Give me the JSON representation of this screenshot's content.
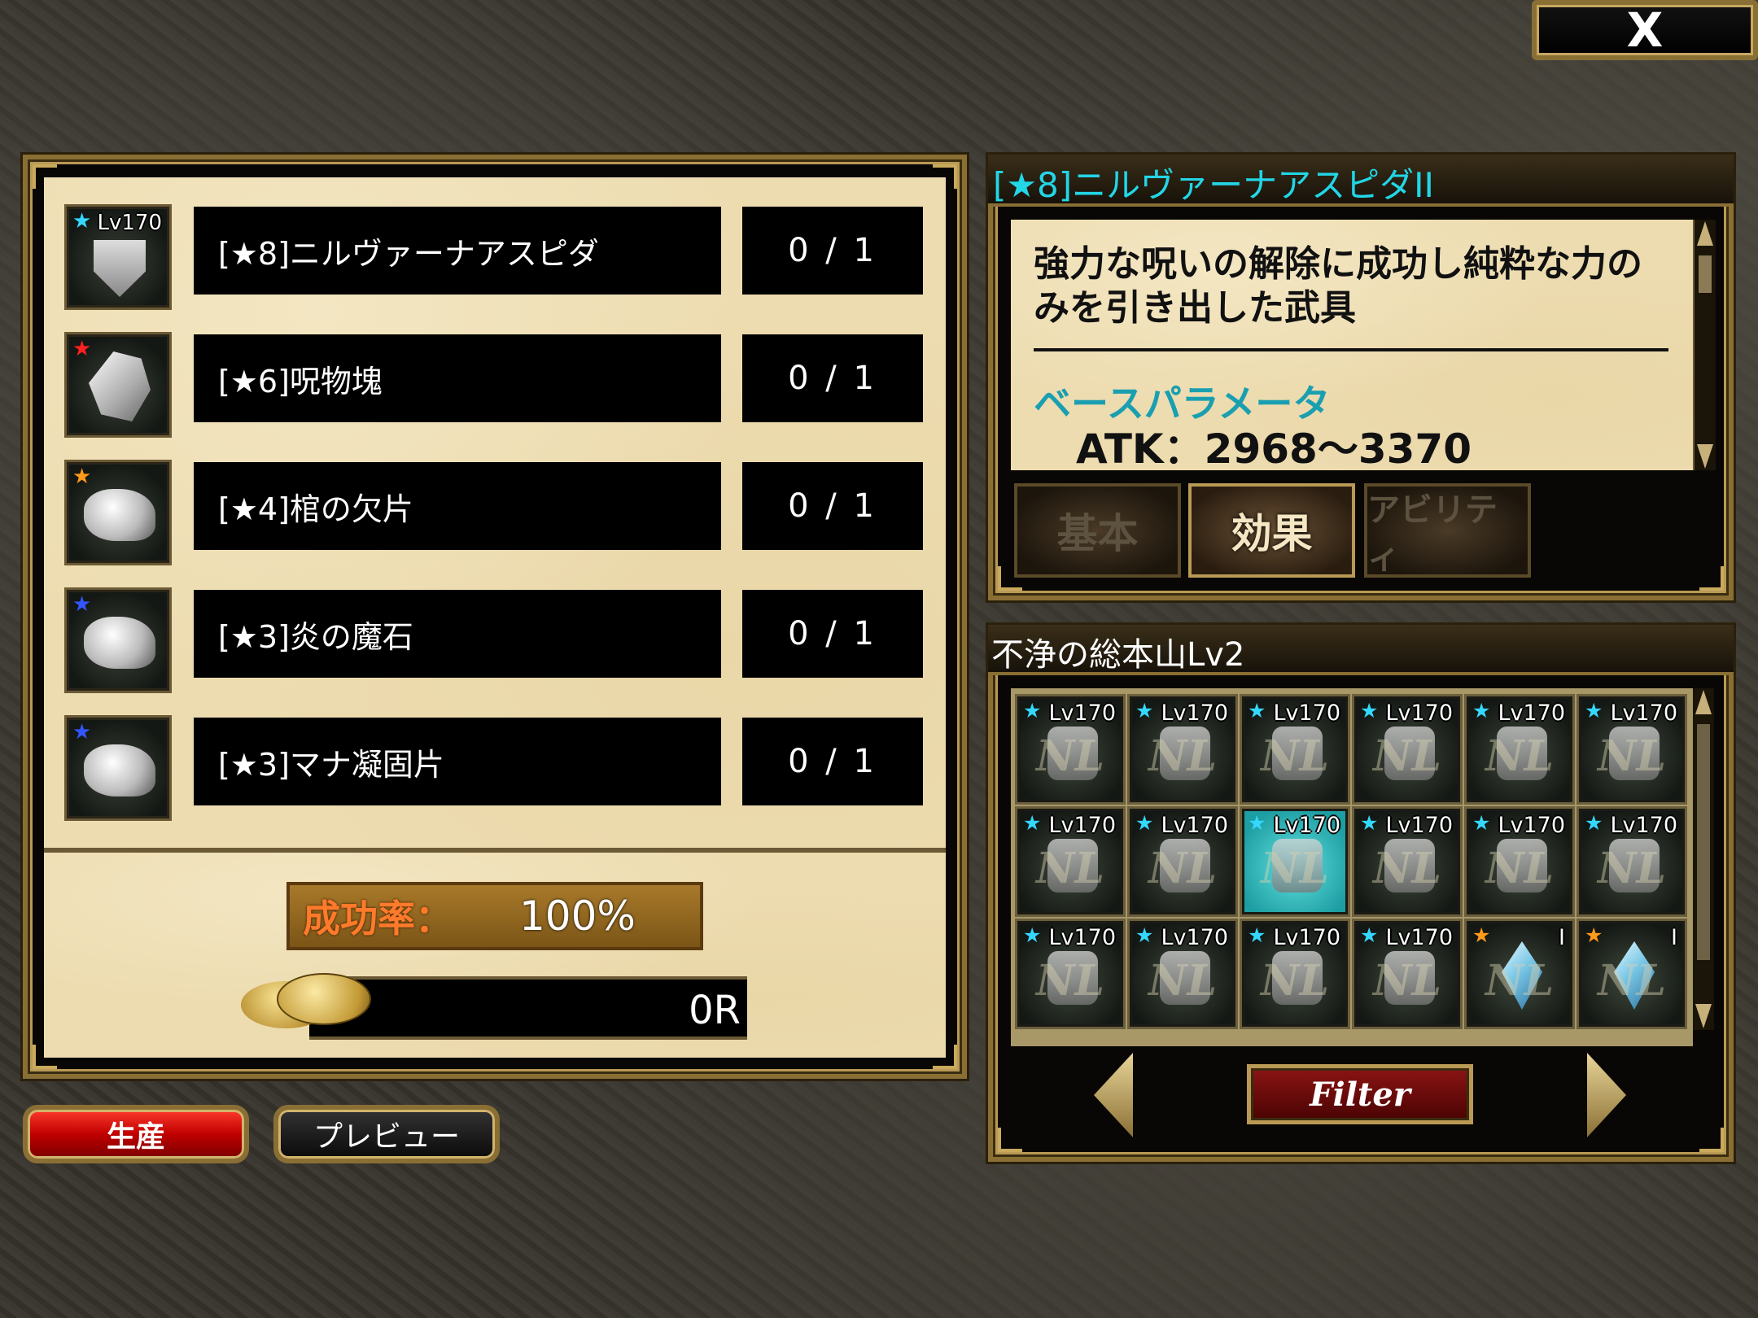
{
  "close_label": "X",
  "recipe": {
    "materials": [
      {
        "name": "[★8]ニルヴァーナアスピダ",
        "count": "0 / 1",
        "star_color": "#34d8ff",
        "lv": "Lv170",
        "icon": "shield-icon"
      },
      {
        "name": "[★6]呪物塊",
        "count": "0 / 1",
        "star_color": "#ff2020",
        "lv": "",
        "icon": "ore-lump-icon"
      },
      {
        "name": "[★4]棺の欠片",
        "count": "0 / 1",
        "star_color": "#ff9a1a",
        "lv": "",
        "icon": "fragment-icon"
      },
      {
        "name": "[★3]炎の魔石",
        "count": "0 / 1",
        "star_color": "#3355ff",
        "lv": "",
        "icon": "fragment-icon"
      },
      {
        "name": "[★3]マナ凝固片",
        "count": "0 / 1",
        "star_color": "#3355ff",
        "lv": "",
        "icon": "fragment-icon"
      }
    ],
    "success_label": "成功率：",
    "success_value": "100%",
    "cost": "0R"
  },
  "buttons": {
    "produce": "生産",
    "preview": "プレビュー"
  },
  "detail": {
    "title": "[★8]ニルヴァーナアスピダII",
    "description": "強力な呪いの解除に成功し純粋な力のみを引き出した武具",
    "param_heading": "ベースパラメータ",
    "param_line": "ATK：2968〜3370",
    "tabs": [
      {
        "label": "基本",
        "active": false
      },
      {
        "label": "効果",
        "active": true
      },
      {
        "label": "アビリティ",
        "active": false
      }
    ]
  },
  "inventory": {
    "title": "不浄の総本山Lv2",
    "filter_label": "Filter",
    "selected_index": 8,
    "items": [
      {
        "lv": "Lv170",
        "star_color": "#34d8ff",
        "type": "equip"
      },
      {
        "lv": "Lv170",
        "star_color": "#34d8ff",
        "type": "equip"
      },
      {
        "lv": "Lv170",
        "star_color": "#34d8ff",
        "type": "equip"
      },
      {
        "lv": "Lv170",
        "star_color": "#34d8ff",
        "type": "equip"
      },
      {
        "lv": "Lv170",
        "star_color": "#34d8ff",
        "type": "equip"
      },
      {
        "lv": "Lv170",
        "star_color": "#34d8ff",
        "type": "equip"
      },
      {
        "lv": "Lv170",
        "star_color": "#34d8ff",
        "type": "equip"
      },
      {
        "lv": "Lv170",
        "star_color": "#34d8ff",
        "type": "equip"
      },
      {
        "lv": "Lv170",
        "star_color": "#34d8ff",
        "type": "equip"
      },
      {
        "lv": "Lv170",
        "star_color": "#34d8ff",
        "type": "equip"
      },
      {
        "lv": "Lv170",
        "star_color": "#34d8ff",
        "type": "equip"
      },
      {
        "lv": "Lv170",
        "star_color": "#34d8ff",
        "type": "equip"
      },
      {
        "lv": "Lv170",
        "star_color": "#34d8ff",
        "type": "equip"
      },
      {
        "lv": "Lv170",
        "star_color": "#34d8ff",
        "type": "equip"
      },
      {
        "lv": "Lv170",
        "star_color": "#34d8ff",
        "type": "equip"
      },
      {
        "lv": "Lv170",
        "star_color": "#34d8ff",
        "type": "equip"
      },
      {
        "lv": "I",
        "star_color": "#ff9a1a",
        "type": "crystal"
      },
      {
        "lv": "I",
        "star_color": "#ff9a1a",
        "type": "crystal"
      }
    ],
    "cell_watermark": "NL"
  }
}
